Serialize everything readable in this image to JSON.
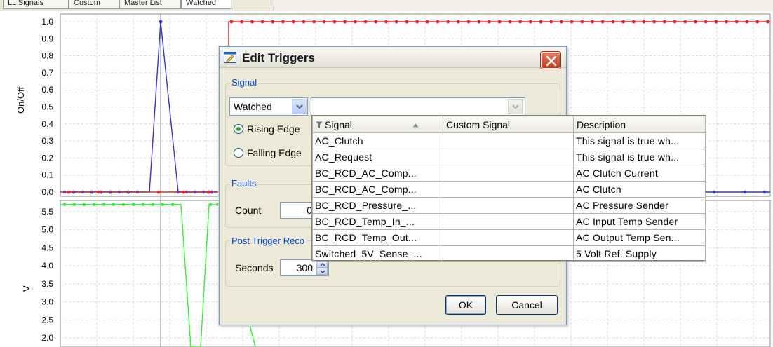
{
  "tabs": [
    "LL Signals",
    "Custom",
    "Master List",
    "Watched"
  ],
  "plot": {
    "upper_y_title": "On/Off",
    "upper_ticks": [
      "1.0",
      "0.9",
      "0.8",
      "0.7",
      "0.6",
      "0.5",
      "0.4",
      "0.3",
      "0.2",
      "0.1",
      "0.0"
    ],
    "lower_y_title": "V",
    "lower_ticks": [
      "5.5",
      "5.0",
      "4.5",
      "4.0",
      "3.5",
      "3.0",
      "2.5",
      "2.0"
    ]
  },
  "chart_data": [
    {
      "type": "line",
      "ylabel": "On/Off",
      "ylim": [
        0,
        1
      ],
      "series": [
        {
          "color": "#3333dd",
          "description": "blue spike trace",
          "values": [
            0,
            0,
            0,
            1,
            0,
            0,
            0,
            0,
            0,
            0,
            0,
            0,
            0,
            0,
            0,
            0
          ]
        },
        {
          "color": "#ee2222",
          "description": "red step trace",
          "values": [
            0,
            0,
            0,
            0,
            0,
            0,
            0,
            1,
            1,
            1,
            1,
            1,
            1,
            1,
            1,
            1
          ]
        }
      ]
    },
    {
      "type": "line",
      "ylabel": "V",
      "ylim": [
        2.0,
        5.5
      ],
      "series": [
        {
          "color": "#33ee33",
          "description": "green voltage trace",
          "values": [
            5.7,
            5.7,
            5.7,
            5.7,
            2.0,
            5.7,
            2.0
          ]
        }
      ]
    }
  ],
  "dialog": {
    "title": "Edit Triggers",
    "signal_group": "Signal",
    "signal_source": "Watched",
    "signal_value": "",
    "rising_edge": "Rising Edge",
    "falling_edge": "Falling Edge",
    "selected_edge": "rising",
    "faults_group": "Faults",
    "count_label": "Count",
    "count_value": "0",
    "post_trigger_group": "Post Trigger Reco",
    "seconds_label": "Seconds",
    "seconds_value": "300",
    "ok_label": "OK",
    "cancel_label": "Cancel"
  },
  "dropdown": {
    "headers": [
      "Signal",
      "Custom Signal",
      "Description"
    ],
    "rows": [
      {
        "signal": "AC_Clutch",
        "custom": "",
        "description": "This signal is true wh..."
      },
      {
        "signal": "AC_Request",
        "custom": "",
        "description": "This signal is true wh..."
      },
      {
        "signal": "BC_RCD_AC_Comp...",
        "custom": "",
        "description": "AC Clutch Current"
      },
      {
        "signal": "BC_RCD_AC_Comp...",
        "custom": "",
        "description": "AC Clutch"
      },
      {
        "signal": "BC_RCD_Pressure_...",
        "custom": "",
        "description": "AC Pressure Sender"
      },
      {
        "signal": "BC_RCD_Temp_In_...",
        "custom": "",
        "description": "AC Input Temp Sender"
      },
      {
        "signal": "BC_RCD_Temp_Out...",
        "custom": "",
        "description": "AC Output Temp Sen..."
      },
      {
        "signal": "Switched_5V_Sense_...",
        "custom": "",
        "description": "5 Volt Ref. Supply"
      }
    ]
  }
}
